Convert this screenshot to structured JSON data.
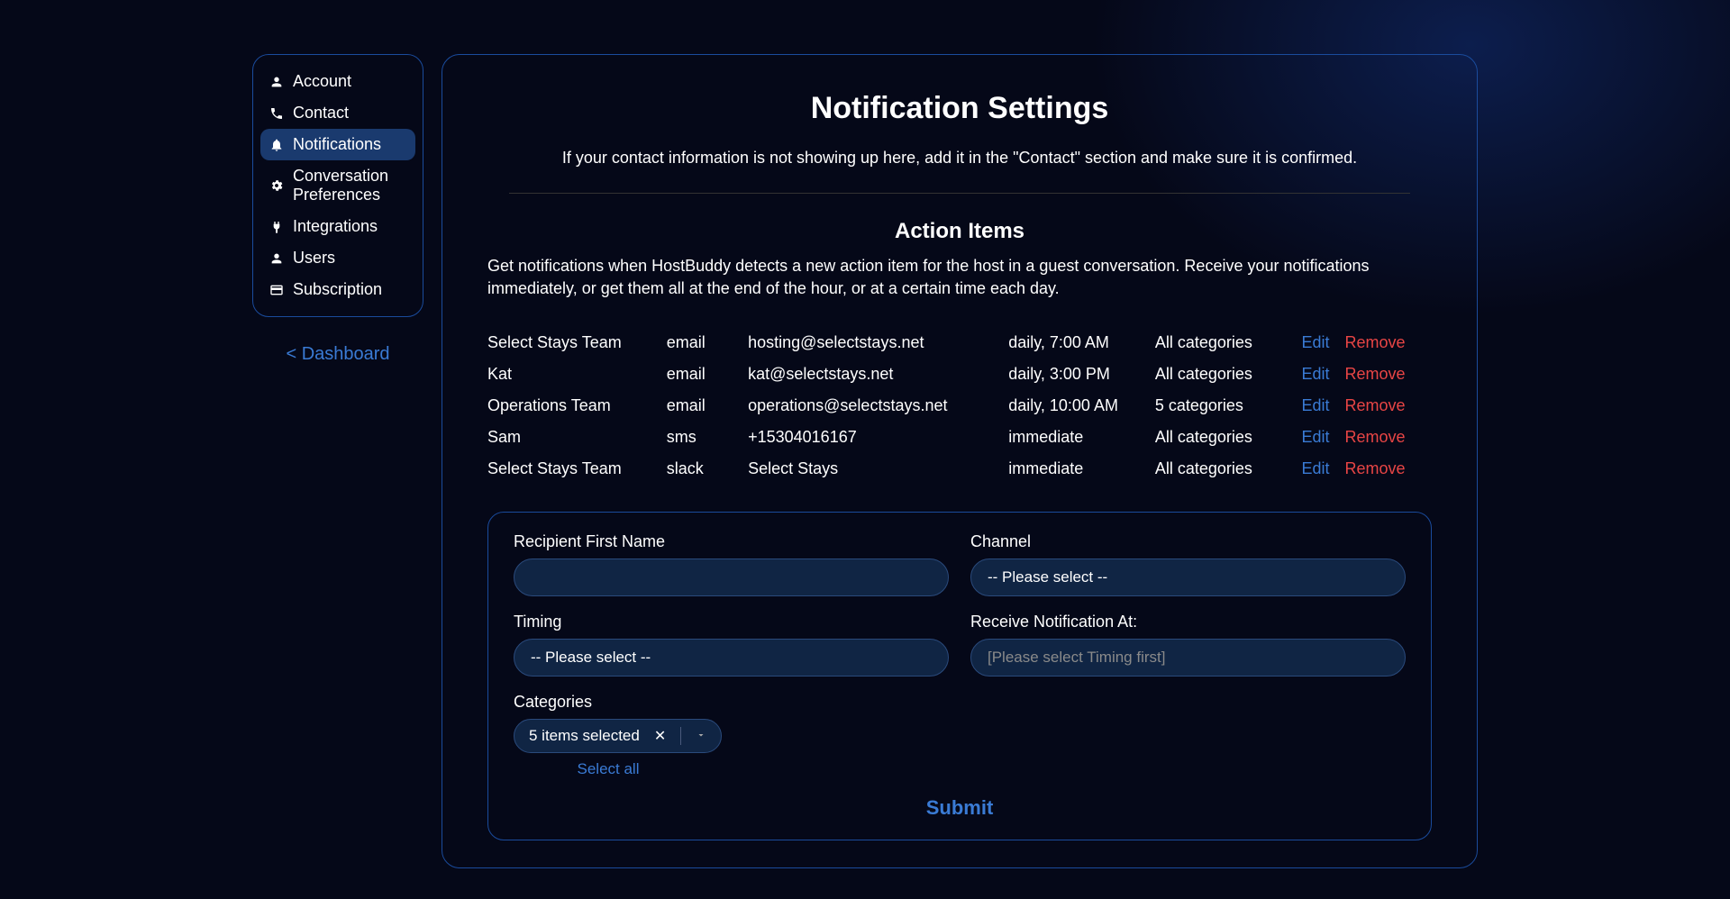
{
  "sidebar": {
    "items": [
      {
        "label": "Account",
        "icon": "user-icon"
      },
      {
        "label": "Contact",
        "icon": "phone-icon"
      },
      {
        "label": "Notifications",
        "icon": "bell-icon",
        "active": true
      },
      {
        "label": "Conversation Preferences",
        "icon": "gear-icon"
      },
      {
        "label": "Integrations",
        "icon": "plug-icon"
      },
      {
        "label": "Users",
        "icon": "user-icon"
      },
      {
        "label": "Subscription",
        "icon": "card-icon"
      }
    ],
    "back_link": "< Dashboard"
  },
  "page": {
    "title": "Notification Settings",
    "subtitle": "If your contact information is not showing up here, add it in the \"Contact\" section and make sure it is confirmed."
  },
  "action_items": {
    "title": "Action Items",
    "description": "Get notifications when HostBuddy detects a new action item for the host in a guest conversation. Receive your notifications immediately, or get them all at the end of the hour, or at a certain time each day.",
    "rows": [
      {
        "name": "Select Stays Team",
        "channel": "email",
        "destination": "hosting@selectstays.net",
        "timing": "daily, 7:00 AM",
        "categories": "All categories"
      },
      {
        "name": "Kat",
        "channel": "email",
        "destination": "kat@selectstays.net",
        "timing": "daily, 3:00 PM",
        "categories": "All categories"
      },
      {
        "name": "Operations Team",
        "channel": "email",
        "destination": "operations@selectstays.net",
        "timing": "daily, 10:00 AM",
        "categories": "5 categories"
      },
      {
        "name": "Sam",
        "channel": "sms",
        "destination": "+15304016167",
        "timing": "immediate",
        "categories": "All categories"
      },
      {
        "name": "Select Stays Team",
        "channel": "slack",
        "destination": "Select Stays",
        "timing": "immediate",
        "categories": "All categories"
      }
    ],
    "edit_label": "Edit",
    "remove_label": "Remove"
  },
  "form": {
    "recipient_label": "Recipient First Name",
    "recipient_value": "",
    "channel_label": "Channel",
    "channel_value": "-- Please select --",
    "timing_label": "Timing",
    "timing_value": "-- Please select --",
    "receive_at_label": "Receive Notification At:",
    "receive_at_value": "[Please select Timing first]",
    "categories_label": "Categories",
    "categories_value": "5 items selected",
    "select_all_label": "Select all",
    "submit_label": "Submit"
  },
  "colors": {
    "accent": "#3a7bd5",
    "danger": "#e84545",
    "border": "#1a4b9c",
    "input_bg": "#102544"
  }
}
